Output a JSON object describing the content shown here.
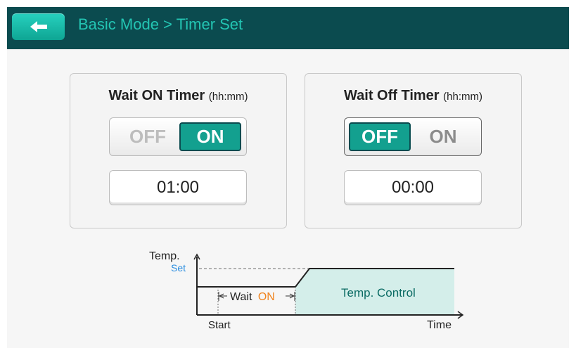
{
  "header": {
    "title": "Basic Mode > Timer Set"
  },
  "wait_on_timer": {
    "title": "Wait ON Timer",
    "unit": "(hh:mm)",
    "off_label": "OFF",
    "on_label": "ON",
    "selected": "ON",
    "time": "01:00"
  },
  "wait_off_timer": {
    "title": "Wait Off Timer",
    "unit": "(hh:mm)",
    "off_label": "OFF",
    "on_label": "ON",
    "selected": "OFF",
    "time": "00:00"
  },
  "diagram": {
    "y_axis_label": "Temp.",
    "set_label": "Set",
    "wait_label": "Wait",
    "wait_on_label": "ON",
    "control_label": "Temp. Control",
    "start_label": "Start",
    "x_axis_label": "Time"
  },
  "colors": {
    "header_bg": "#0b4b4f",
    "accent": "#13a08f",
    "title_text": "#23c5b3",
    "set_blue": "#2a8de0",
    "on_orange": "#f0841f",
    "control_fill": "#d4eeea"
  }
}
